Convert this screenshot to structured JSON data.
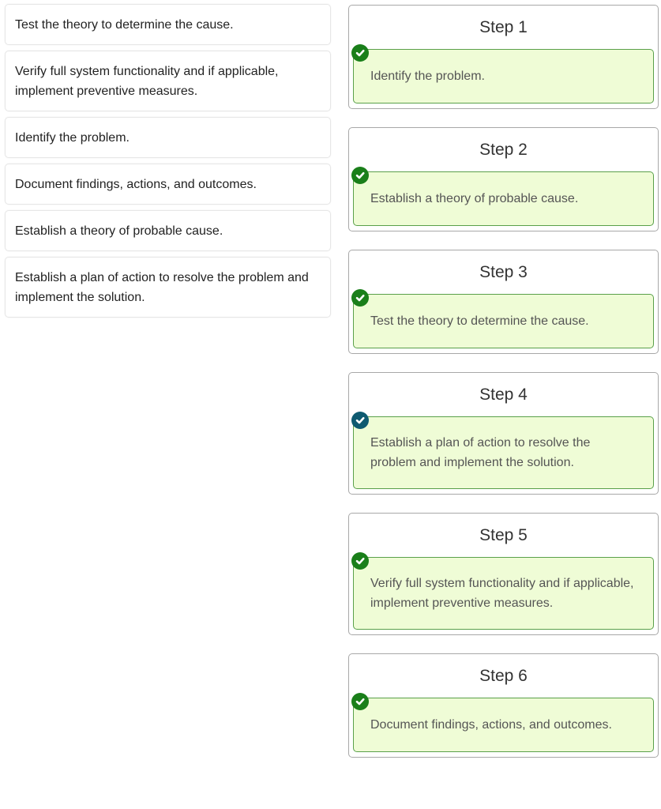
{
  "options": [
    {
      "text": "Test the theory to determine the cause."
    },
    {
      "text": "Verify full system functionality and if applicable, implement preventive measures."
    },
    {
      "text": "Identify the problem."
    },
    {
      "text": "Document findings, actions, and outcomes."
    },
    {
      "text": "Establish a theory of probable cause."
    },
    {
      "text": "Establish a plan of action to resolve the problem and implement the solution."
    }
  ],
  "steps": [
    {
      "title": "Step 1",
      "answer": "Identify the problem.",
      "status": "correct",
      "icon": "check-circle-icon"
    },
    {
      "title": "Step 2",
      "answer": "Establish a theory of probable cause.",
      "status": "correct",
      "icon": "check-circle-icon"
    },
    {
      "title": "Step 3",
      "answer": "Test the theory to determine the cause.",
      "status": "correct",
      "icon": "check-circle-icon"
    },
    {
      "title": "Step 4",
      "answer": "Establish a plan of action to resolve the problem and implement the solution.",
      "status": "selected",
      "icon": "check-circle-icon"
    },
    {
      "title": "Step 5",
      "answer": "Verify full system functionality and if applicable, implement preventive measures.",
      "status": "correct",
      "icon": "check-circle-icon"
    },
    {
      "title": "Step 6",
      "answer": "Document findings, actions, and outcomes.",
      "status": "correct",
      "icon": "check-circle-icon"
    }
  ],
  "colors": {
    "correct_check": "#1a7f1a",
    "selected_check": "#0e5a70",
    "answer_bg": "#effcd6",
    "answer_border": "#5aa04a"
  }
}
